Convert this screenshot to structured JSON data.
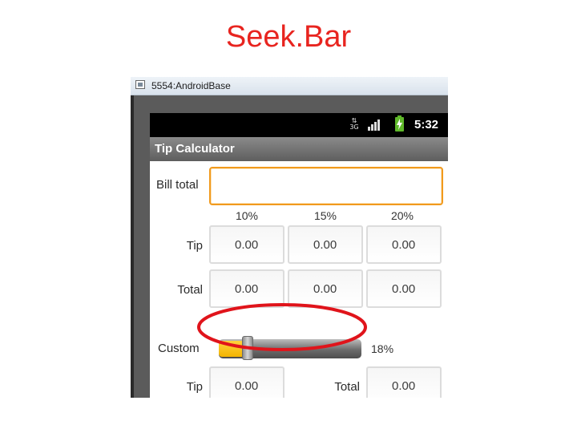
{
  "slide": {
    "title": "Seek.Bar"
  },
  "emulator": {
    "window_title": "5554:AndroidBase"
  },
  "statusbar": {
    "network": "3G",
    "time": "5:32"
  },
  "app": {
    "title": "Tip Calculator"
  },
  "form": {
    "bill_label": "Bill total",
    "bill_value": "",
    "percent_headers": [
      "10%",
      "15%",
      "20%"
    ],
    "tip_label": "Tip",
    "tip_values": [
      "0.00",
      "0.00",
      "0.00"
    ],
    "total_label": "Total",
    "total_values": [
      "0.00",
      "0.00",
      "0.00"
    ],
    "custom_label": "Custom",
    "custom_percent": "18%",
    "custom_tip_label": "Tip",
    "custom_tip_value": "0.00",
    "custom_total_label": "Total",
    "custom_total_value": "0.00"
  },
  "seekbar": {
    "progress_fraction": 0.2
  },
  "colors": {
    "slide_title": "#e8241f",
    "highlight_ellipse": "#e0141b",
    "input_focus": "#f19a1d",
    "seek_progress": "#f3b400"
  }
}
